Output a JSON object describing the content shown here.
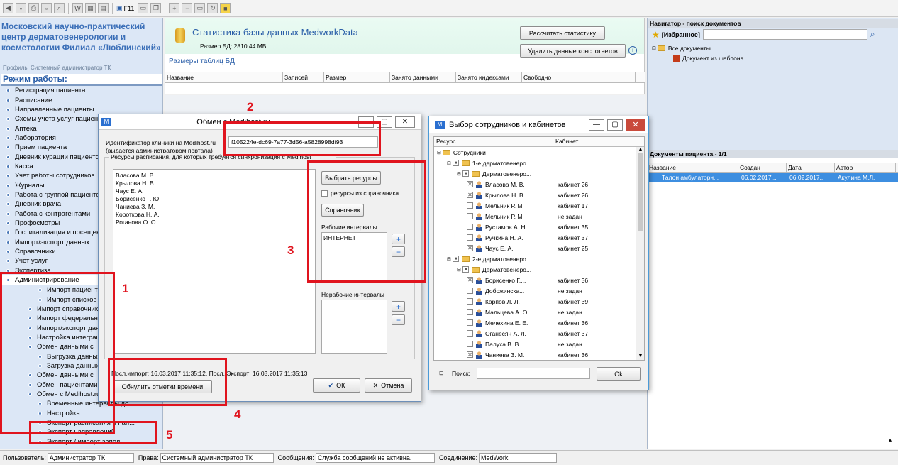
{
  "toolbar": {
    "f11_label": "F11"
  },
  "left": {
    "org": "Московский научно-практический центр дерматовенерологии и косметологии Филиал «Люблинский»",
    "profile": "Профиль: Системный администратор ТК",
    "mode_header": "Режим работы:",
    "items": [
      "Регистрация пациента",
      "Расписание",
      "Направленные пациенты",
      "Схемы учета услуг пациентов",
      "Аптека",
      "Лаборатория",
      "Прием пациента",
      "Дневник курации пациентов",
      "Касса",
      "Учет работы сотрудников",
      "Журналы",
      "Работа с группой пациентов",
      "Дневник врача",
      "Работа с контрагентами",
      "Профосмотры",
      "Госпитализация и посещения",
      "Импорт/экспорт данных",
      "Справочники",
      "Учет услуг",
      "Экспертиза",
      "Администрирование"
    ],
    "subitems": [
      {
        "label": "Импорт пациентов",
        "indent": 3
      },
      {
        "label": "Импорт списков",
        "indent": 3
      },
      {
        "label": "Импорт справочников",
        "indent": 2
      },
      {
        "label": "Импорт федеральных",
        "indent": 2
      },
      {
        "label": "Импорт/экспорт данных",
        "indent": 2
      },
      {
        "label": "Настройка интеграции",
        "indent": 2
      },
      {
        "label": "Обмен данными с",
        "indent": 2
      },
      {
        "label": "Выгрузка данных",
        "indent": 3
      },
      {
        "label": "Загрузка данных",
        "indent": 3
      },
      {
        "label": "Обмен данными с",
        "indent": 2
      },
      {
        "label": "Обмен пациентами с",
        "indent": 2
      },
      {
        "label": "Обмен с Medihost.ru",
        "indent": 2
      },
      {
        "label": "Временные интервалы до...",
        "indent": 3
      },
      {
        "label": "Настройка",
        "indent": 3
      },
      {
        "label": "Экспорт расписания и нап...",
        "indent": 3
      },
      {
        "label": "Экспорт направлений",
        "indent": 3
      },
      {
        "label": "Экспорт / импорт запол",
        "indent": 3
      }
    ]
  },
  "stats": {
    "title": "Статистика базы данных MedworkData",
    "size": "Размер БД: 2810.44 MB",
    "calc_button": "Рассчитать статистику",
    "delete_button": "Удалить данные конс. отчетов",
    "sizes_label": "Размеры таблиц БД",
    "columns": [
      "Название",
      "Записей",
      "Размер",
      "Занято данными",
      "Занято индексами",
      "Свободно"
    ]
  },
  "navigator": {
    "header": "Навигатор - поиск документов",
    "favorites": "[Избранное]",
    "all_docs": "Все документы",
    "doc_template": "Документ из шаблона"
  },
  "patient_docs": {
    "header": "Документы пациента - 1/1",
    "columns": [
      "Название",
      "Создан",
      "Дата",
      "Автор"
    ],
    "row": {
      "name": "Талон амбулаторн...",
      "created": "06.02.2017...",
      "date": "06.02.2017...",
      "author": "Акулина М.Л."
    }
  },
  "medihost": {
    "title": "Обмен с Medihost.ru",
    "id_label_1": "Идентификатор клиники на Medihost.ru",
    "id_label_2": "(выдается администратором портала)",
    "id_value": "f105224e-dc69-7a77-3d56-a5828998df93",
    "resources_group": "Ресурсы расписания, для которых требуется синхронизация с Medihost",
    "resources": [
      "Власова М. В.",
      "Крылова Н. В.",
      "Чаус Е. А.",
      "Борисенко Г. Ю.",
      "Чаниева З. М.",
      "Короткова Н. А.",
      "Роганова О. О."
    ],
    "select_resources": "Выбрать ресурсы",
    "from_directory": "ресурсы из справочника",
    "directory": "Справочник",
    "work_intervals": "Рабочие интервалы",
    "work_interval_value": "ИНТЕРНЕТ",
    "nonwork_intervals": "Нерабочие интервалы",
    "last_import": "Посл.импорт: 16.03.2017 11:35:12, Посл. Экспорт: 16.03.2017 11:35:13",
    "reset_button": "Обнулить отметки времени",
    "ok": "ОК",
    "cancel": "Отмена"
  },
  "staff": {
    "title": "Выбор сотрудников и кабинетов",
    "col_resource": "Ресурс",
    "col_room": "Кабинет",
    "tree": [
      {
        "t": "f",
        "lvl": 0,
        "name": "Сотрудники",
        "room": "",
        "chk": ""
      },
      {
        "t": "f",
        "lvl": 1,
        "name": "1-е дерматовенеро...",
        "room": "",
        "chk": "-"
      },
      {
        "t": "f",
        "lvl": 2,
        "name": "Дерматовенеро...",
        "room": "",
        "chk": "-"
      },
      {
        "t": "u",
        "lvl": 3,
        "name": "Власова М. В.",
        "room": "кабинет 26",
        "chk": "x"
      },
      {
        "t": "u",
        "lvl": 3,
        "name": "Крылова Н. В.",
        "room": "кабинет 26",
        "chk": "x"
      },
      {
        "t": "u",
        "lvl": 3,
        "name": "Мельник Р. М.",
        "room": "кабинет 17",
        "chk": ""
      },
      {
        "t": "u",
        "lvl": 3,
        "name": "Мельник Р. М.",
        "room": "не задан",
        "chk": ""
      },
      {
        "t": "u",
        "lvl": 3,
        "name": "Рустамов А. Н.",
        "room": "кабинет 35",
        "chk": ""
      },
      {
        "t": "u",
        "lvl": 3,
        "name": "Ручкина Н. А.",
        "room": "кабинет 37",
        "chk": ""
      },
      {
        "t": "u",
        "lvl": 3,
        "name": "Чаус Е. А.",
        "room": "кабинет 25",
        "chk": "x"
      },
      {
        "t": "f",
        "lvl": 1,
        "name": "2-е дерматовенеро...",
        "room": "",
        "chk": "-"
      },
      {
        "t": "f",
        "lvl": 2,
        "name": "Дерматовенеро...",
        "room": "",
        "chk": "-"
      },
      {
        "t": "u",
        "lvl": 3,
        "name": "Борисенко Г....",
        "room": "кабинет 36",
        "chk": "x"
      },
      {
        "t": "u",
        "lvl": 3,
        "name": "Добржинска...",
        "room": "не задан",
        "chk": ""
      },
      {
        "t": "u",
        "lvl": 3,
        "name": "Карпов Л. Л.",
        "room": "кабинет 39",
        "chk": ""
      },
      {
        "t": "u",
        "lvl": 3,
        "name": "Мальцева А. О.",
        "room": "не задан",
        "chk": ""
      },
      {
        "t": "u",
        "lvl": 3,
        "name": "Мелехина Е. Е.",
        "room": "кабинет 36",
        "chk": ""
      },
      {
        "t": "u",
        "lvl": 3,
        "name": "Оганесян А. Л.",
        "room": "кабинет 37",
        "chk": ""
      },
      {
        "t": "u",
        "lvl": 3,
        "name": "Палуха В. В.",
        "room": "не задан",
        "chk": ""
      },
      {
        "t": "u",
        "lvl": 3,
        "name": "Чаниева З. М.",
        "room": "кабинет 36",
        "chk": "x"
      }
    ],
    "search_label": "Поиск:",
    "ok": "Ok"
  },
  "status": {
    "user_label": "Пользователь:",
    "user": "Администратор ТК",
    "rights_label": "Права:",
    "rights": "Системный администратор ТК",
    "messages_label": "Сообщения:",
    "messages": "Служба сообщений не активна.",
    "connection_label": "Соединение:",
    "connection": "MedWork"
  },
  "annotations": [
    "1",
    "2",
    "3",
    "4",
    "5"
  ]
}
